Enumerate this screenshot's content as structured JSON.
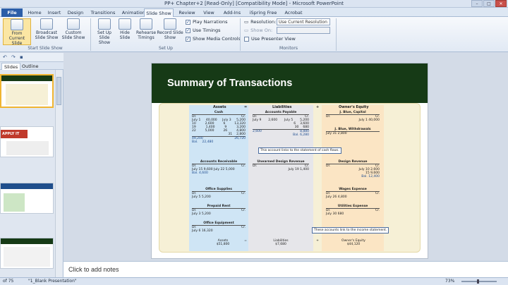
{
  "window": {
    "title": "PP+ Chapter+2 [Read-Only] [Compatibility Mode]  -  Microsoft PowerPoint"
  },
  "tabs": [
    "File",
    "Home",
    "Insert",
    "Design",
    "Transitions",
    "Animations",
    "Slide Show",
    "Review",
    "View",
    "Add-Ins",
    "iSpring Free",
    "Acrobat"
  ],
  "ribbon": {
    "start_group": {
      "label": "Start Slide Show",
      "from_beginning": "From Beginning",
      "from_current": "From Current Slide",
      "broadcast": "Broadcast Slide Show",
      "custom": "Custom Slide Show"
    },
    "setup_group": {
      "label": "Set Up",
      "setup": "Set Up Slide Show",
      "hide": "Hide Slide",
      "rehearse": "Rehearse Timings",
      "record": "Record Slide Show",
      "play_narrations": "Play Narrations",
      "use_timings": "Use Timings",
      "show_media": "Show Media Controls"
    },
    "monitors_group": {
      "label": "Monitors",
      "resolution_label": "Resolution:",
      "resolution_value": "Use Current Resolution",
      "show_on_label": "Show On:",
      "presenter_view": "Use Presenter View"
    }
  },
  "left_pane": {
    "tab_slides": "Slides",
    "tab_outline": "Outline"
  },
  "slide": {
    "title": "Summary of Transactions",
    "headers": {
      "assets": "Assets",
      "eq": "=",
      "liabilities": "Liabilities",
      "plus": "+",
      "equity": "Owner's Equity"
    },
    "cash": {
      "name": "Cash",
      "dr": "Dr.",
      "cr": "Cr.",
      "rows": [
        {
          "l": "July  1",
          "lv": "40,000",
          "r": "July  3",
          "rv": "5,200"
        },
        {
          "l": "10",
          "lv": "2,600",
          "r": "6",
          "rv": "13,320"
        },
        {
          "l": "19",
          "lv": "1,400",
          "r": "9",
          "rv": "3,200"
        },
        {
          "l": "22",
          "lv": "5,000",
          "r": "26",
          "rv": "4,800"
        },
        {
          "l": "",
          "lv": "",
          "r": "31",
          "rv": "2,800"
        }
      ],
      "totals": {
        "lv": "49,200",
        "rv": "26,720"
      },
      "bal": "Bal.",
      "balv": "22,480"
    },
    "ar": {
      "name": "Accounts Receivable",
      "dr": "Dr.",
      "cr": "Cr.",
      "row": "July  15   9,600  July  22   5,000",
      "bal": "Bal.   4,600"
    },
    "ap": {
      "name": "Accounts Payable",
      "dr": "Dr.",
      "cr": "Cr.",
      "rows": [
        {
          "l": "July  9",
          "lv": "2,600",
          "r": "July  5",
          "rv": "5,200"
        },
        {
          "l": "",
          "lv": "",
          "r": "6",
          "rv": "3,600"
        },
        {
          "l": "",
          "lv": "",
          "r": "30",
          "rv": "680"
        }
      ],
      "totals": {
        "lv": "2,600",
        "rv": "8,880"
      },
      "bal": "Bal.   6,280"
    },
    "udr": {
      "name": "Unearned Design Revenue",
      "dr": "Dr.",
      "cr": "Cr.",
      "row": "July  19    1,400"
    },
    "capital": {
      "name": "J. Blue, Capital",
      "dr": "Dr.",
      "cr": "Cr.",
      "row": "July  1   40,000"
    },
    "withdrawals": {
      "name": "J. Blue, Withdrawals",
      "row": "July  31   2,800"
    },
    "design_rev": {
      "name": "Design Revenue",
      "dr": "Dr.",
      "cr": "Cr.",
      "rows": [
        "July  10    2,600",
        "15    9,600",
        "Bal.  12,400"
      ]
    },
    "supplies": {
      "name": "Office Supplies",
      "dr": "Dr.",
      "cr": "Cr.",
      "row": "July  5   5,200"
    },
    "wages": {
      "name": "Wages Expense",
      "dr": "Dr.",
      "cr": "Cr.",
      "row": "July  26   4,800"
    },
    "rent": {
      "name": "Prepaid Rent",
      "dr": "Dr.",
      "cr": "Cr.",
      "row": "July  3   5,200"
    },
    "utilities": {
      "name": "Utilities Expense",
      "dr": "Dr.",
      "cr": "Cr.",
      "row": "July  30     680"
    },
    "equipment": {
      "name": "Office Equipment",
      "dr": "Dr.",
      "cr": "Cr.",
      "row": "July  6   16,320"
    },
    "note_cash": "This account links to the statement of cash flows.",
    "note_income": "These accounts link to the income statement.",
    "totals": {
      "assets_label": "Assets",
      "assets": "$51,800",
      "eq": "=",
      "liab_label": "Liabilities",
      "liab": "$7,680",
      "plus": "+",
      "equity_label": "Owner's Equity",
      "equity": "$44,120"
    }
  },
  "thumbs": {
    "t2": "APPLY IT"
  },
  "notes": {
    "placeholder": "Click to add notes"
  },
  "status": {
    "slide": "of 75",
    "theme": "\"1_Blank Presentation\"",
    "zoom": "73%"
  }
}
